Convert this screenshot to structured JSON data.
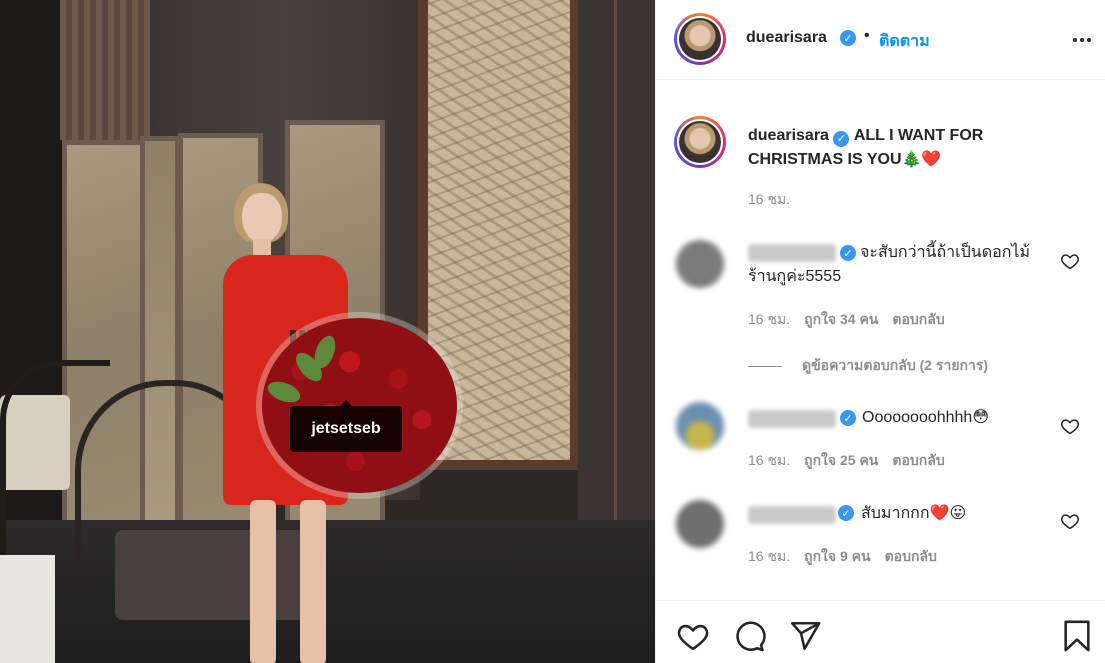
{
  "photo": {
    "tag_label": "jetsetseb"
  },
  "header": {
    "username": "duearisara",
    "verified_mark": "✓",
    "separator": "•",
    "follow_label": "ติดตาม"
  },
  "caption": {
    "username": "duearisara",
    "text": "ALL I WANT FOR CHRISTMAS IS YOU🎄❤️",
    "time": "16 ชม."
  },
  "comments": [
    {
      "text": "จะสับกว่านี้ถ้าเป็นดอกไม้ร้านกูค่ะ5555",
      "time": "16 ชม.",
      "likes": "ถูกใจ 34 คน",
      "reply_label": "ตอบกลับ",
      "avatar_color": "#7a7a7a"
    },
    {
      "text": "Oooooooohhhh😳",
      "time": "16 ชม.",
      "likes": "ถูกใจ 25 คน",
      "reply_label": "ตอบกลับ",
      "avatar_color": "#6a8fb0"
    },
    {
      "text": "สับมากกก❤️😛",
      "time": "16 ชม.",
      "likes": "ถูกใจ 9 คน",
      "reply_label": "ตอบกลับ",
      "avatar_color": "#6e6e6e"
    }
  ],
  "view_replies": "ดูข้อความตอบกลับ (2 รายการ)",
  "colors": {
    "link_blue": "#0095f6",
    "verified_blue": "#3897f0",
    "muted_text": "#8e8e8e",
    "primary_text": "#262626"
  },
  "icons": [
    "more-options-icon",
    "verified-icon",
    "heart-icon",
    "comment-icon",
    "share-icon",
    "bookmark-icon"
  ]
}
